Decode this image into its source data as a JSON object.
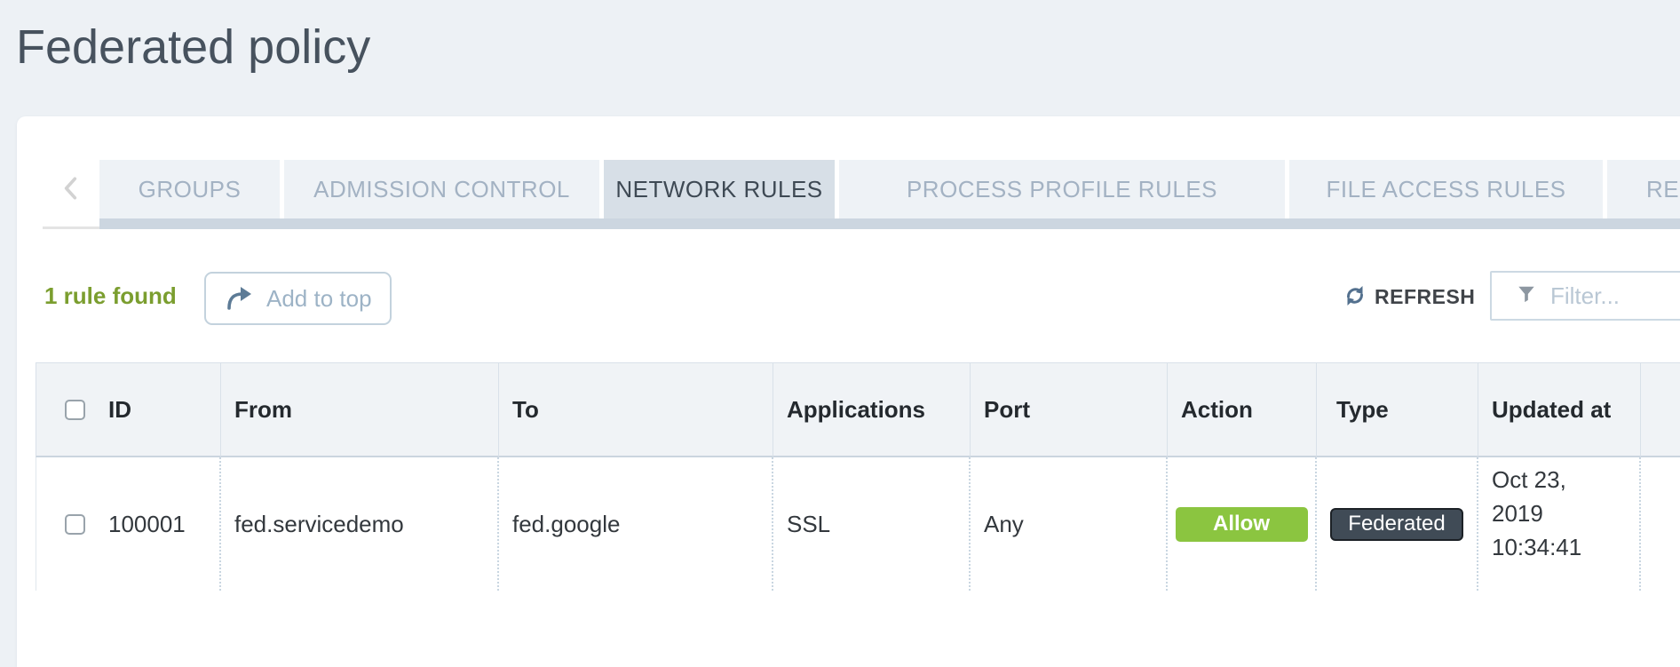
{
  "page": {
    "title": "Federated policy"
  },
  "tabs": {
    "items": [
      {
        "label": "GROUPS",
        "active": false
      },
      {
        "label": "ADMISSION CONTROL",
        "active": false
      },
      {
        "label": "NETWORK RULES",
        "active": true
      },
      {
        "label": "PROCESS PROFILE RULES",
        "active": false
      },
      {
        "label": "FILE ACCESS RULES",
        "active": false
      },
      {
        "label": "RES",
        "active": false
      }
    ]
  },
  "toolbar": {
    "rules_found": "1 rule found",
    "add_to_top_label": "Add to top",
    "refresh_label": "REFRESH",
    "filter_placeholder": "Filter...",
    "filter_value": ""
  },
  "table": {
    "columns": [
      "ID",
      "From",
      "To",
      "Applications",
      "Port",
      "Action",
      "Type",
      "Updated at"
    ],
    "rows": [
      {
        "id": "100001",
        "from": "fed.servicedemo",
        "to": "fed.google",
        "applications": "SSL",
        "port": "Any",
        "action": "Allow",
        "type": "Federated",
        "updated_at": "Oct 23, 2019 10:34:41",
        "selected": false
      }
    ]
  },
  "colors": {
    "page_background": "#edf1f5",
    "title_text": "#47525e",
    "active_tab_background": "#d7dfe7",
    "inactive_tab_text": "#a3b2c3",
    "rules_found_green": "#7b9e2f",
    "allow_badge_green": "#8bc540",
    "federated_badge_dark": "#404b56",
    "table_header_background": "#f0f3f6"
  }
}
